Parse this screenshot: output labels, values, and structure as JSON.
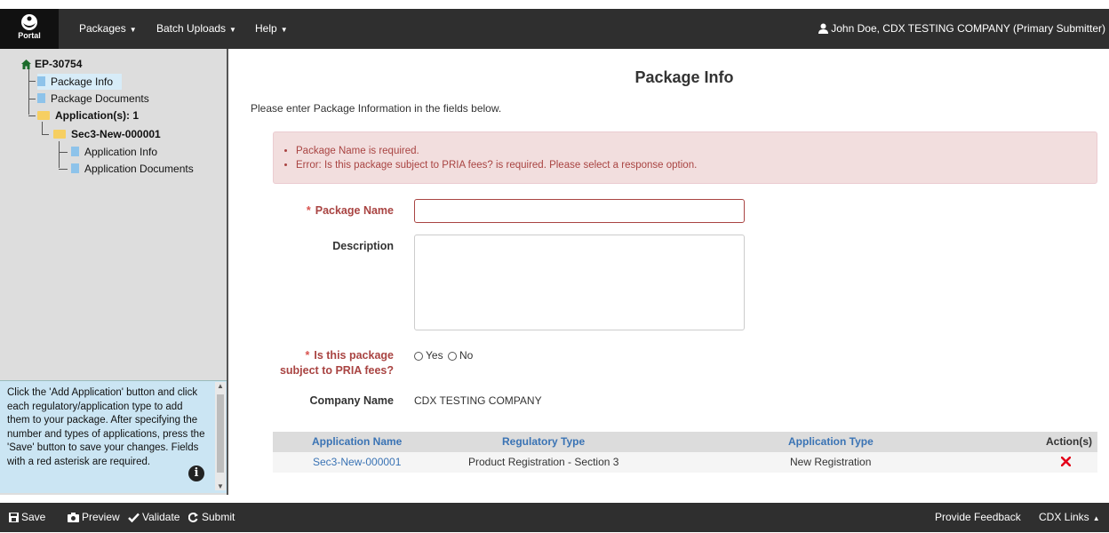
{
  "logo": {
    "text": "Portal"
  },
  "nav": {
    "packages": "Packages",
    "batch_uploads": "Batch Uploads",
    "help": "Help",
    "user": "John Doe, CDX TESTING COMPANY (Primary Submitter)"
  },
  "tree": {
    "root": "EP-30754",
    "package_info": "Package Info",
    "package_documents": "Package Documents",
    "applications": "Application(s): 1",
    "app": "Sec3-New-000001",
    "application_info": "Application Info",
    "application_documents": "Application Documents"
  },
  "help_text": "Click the 'Add Application' button and click each regulatory/application type to add them to your package. After specifying the number and types of applications, press the 'Save' button to save your changes. Fields with a red asterisk are required.",
  "page_title": "Package Info",
  "intro": "Please enter Package Information in the fields below.",
  "errors": [
    "Package Name is required.",
    "Error: Is this package subject to PRIA fees? is required. Please select a response option."
  ],
  "form": {
    "package_name_label": "Package Name",
    "package_name_value": "",
    "description_label": "Description",
    "description_value": "",
    "pria_label_1": "Is this package",
    "pria_label_2": "subject to PRIA fees?",
    "yes": "Yes",
    "no": "No",
    "company_label": "Company Name",
    "company_value": "CDX TESTING COMPANY"
  },
  "table": {
    "headers": [
      "Application Name",
      "Regulatory Type",
      "Application Type",
      "Action(s)"
    ],
    "rows": [
      {
        "name": "Sec3-New-000001",
        "regulatory_type": "Product Registration - Section 3",
        "application_type": "New Registration"
      }
    ]
  },
  "footer": {
    "save": "Save",
    "preview": "Preview",
    "validate": "Validate",
    "submit": "Submit",
    "feedback": "Provide Feedback",
    "cdx_links": "CDX Links"
  },
  "colors": {
    "error": "#a94442",
    "link": "#3a73b4",
    "bar": "#2f2f2f"
  }
}
